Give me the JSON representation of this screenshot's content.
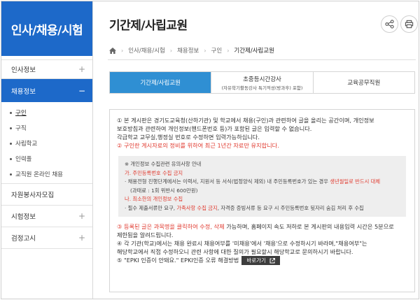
{
  "sidebar": {
    "title": "인사/채용/시험",
    "items": [
      {
        "label": "인사정보",
        "toggle": "+"
      },
      {
        "label": "채용정보",
        "toggle": "−"
      },
      {
        "label": "자원봉사자모집",
        "toggle": ""
      },
      {
        "label": "시험정보",
        "toggle": "+"
      },
      {
        "label": "검정고시",
        "toggle": "+"
      }
    ],
    "subitems": [
      "구인",
      "구직",
      "사립학교",
      "인력풀",
      "교직원 온라인 채용"
    ]
  },
  "header": {
    "title": "기간제/사립교원",
    "share_icon": "share-icon",
    "print_icon": "print-icon"
  },
  "breadcrumb": [
    "인사/채용/시험",
    "채용정보",
    "구인",
    "기간제/사립교원"
  ],
  "tabs": [
    {
      "label": "기간제/사립교원",
      "sub": ""
    },
    {
      "label": "초중등시간강사",
      "sub": "(자유학기활동강사 특기적성(방과후) 포함)"
    },
    {
      "label": "교육공무직원",
      "sub": ""
    }
  ],
  "notice": {
    "p1a": "① 본 게시판은 경기도교육청(산하기관) 및 학교에서 채용(구인)과 관련하여 글을 올리는 공간이며, 개인정보",
    "p1b": "보호방침과 관련하여 개인정보(핸드폰번호 등)가 포함된 글은 입력할 수 없습니다.",
    "p1c": "각급학교 교무실,행정실 번호로 수정하면 입력가능하십니다.",
    "p2": "② 구인란 게시자료의 정비를 위하여 최근 1년간 자료만 유지합니다.",
    "inner": {
      "title": "※ 개인정보 수집관련 유의사항 안내",
      "ga": "가. 주민등록번호 수집 금지",
      "ga1_pre": "· 채용전형 진행단계에서는 이력서, 지원서 등 서식(법정양식 제외) 내 주민등록번호가 있는 경우 ",
      "ga1_red": "생년월일로 반드시 대체",
      "ga2": "(과태료 : 1회 위반시 600만원)",
      "na": "나. 최소한의 개인정보 수집",
      "na1_pre": "· 필수 제출서류만 요구, ",
      "na1_red": "가족사항 수집 금지",
      "na1_post": ", 자격증 증빙서류 등 요구 시 주민등록번호 뒷자리 숨김 처리 후 수집"
    },
    "p3_red": "③ 등록된 글은 과목명을 클릭하여 수정, 삭제",
    "p3_rest": " 가능하며, 홈페이지 속도 저하로 본 게시판의 내용입력 시간은 5분으로",
    "p3b": "제한됨을 알려드립니다.",
    "p4a": "④ 각 기관(학교)에서는 채용 완료시 채용여부를 '미채용'에서 '채용'으로 수정하시기 바라며,\"채용여부\"는",
    "p4b": "해당학교에서 직접 수정하오니 관련 사항에 대한 질의가 필요할시 해당학교로 문의하시기 바랍니다.",
    "p5": "⑤ \"EPKI 인증이 안돼요.\" EPKI인증 오류 해결방법",
    "goto_label": "바로가기"
  },
  "colors": {
    "brand": "#1d69c9",
    "tab_active": "#2f8fd3",
    "warning": "#e03a2f"
  }
}
